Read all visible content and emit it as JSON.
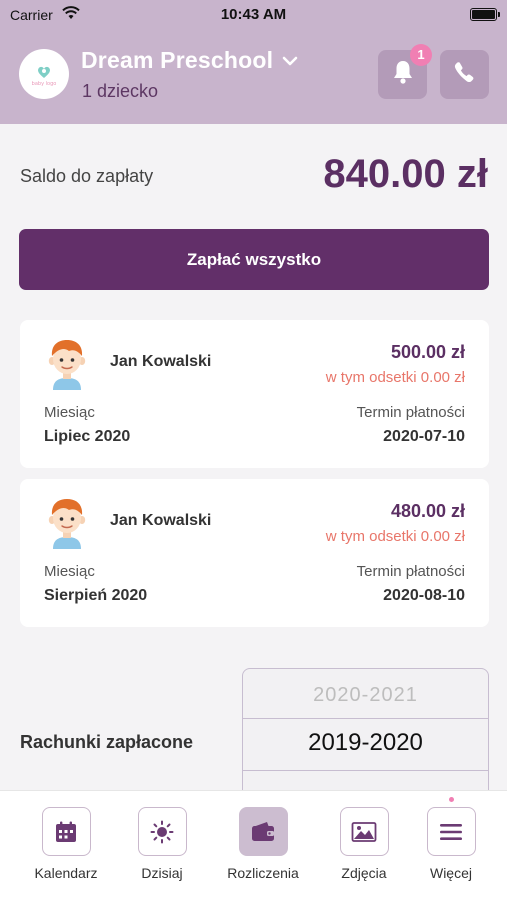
{
  "status_bar": {
    "carrier": "Carrier",
    "time": "10:43 AM"
  },
  "header": {
    "school_name": "Dream Preschool",
    "child_count": "1 dziecko",
    "notification_count": "1",
    "logo_text": "baby logo",
    "icons": [
      "bell-icon",
      "phone-icon",
      "chevron-down-icon"
    ]
  },
  "balance": {
    "label": "Saldo do zapłaty",
    "amount": "840.00 zł",
    "pay_all_label": "Zapłać wszystko"
  },
  "bills": [
    {
      "child_name": "Jan Kowalski",
      "amount": "500.00 zł",
      "interest": "w tym odsetki 0.00 zł",
      "month_label": "Miesiąc",
      "month": "Lipiec 2020",
      "due_label": "Termin płatności",
      "due_date": "2020-07-10"
    },
    {
      "child_name": "Jan Kowalski",
      "amount": "480.00 zł",
      "interest": "w tym odsetki 0.00 zł",
      "month_label": "Miesiąc",
      "month": "Sierpień 2020",
      "due_label": "Termin płatności",
      "due_date": "2020-08-10"
    }
  ],
  "paid": {
    "label": "Rachunki zapłacone",
    "year_options": [
      "2020-2021",
      "2019-2020"
    ],
    "selected_year": "2019-2020"
  },
  "tabs": [
    {
      "label": "Kalendarz",
      "icon": "calendar-icon",
      "active": false
    },
    {
      "label": "Dzisiaj",
      "icon": "sun-icon",
      "active": false
    },
    {
      "label": "Rozliczenia",
      "icon": "wallet-icon",
      "active": true
    },
    {
      "label": "Zdjęcia",
      "icon": "photo-icon",
      "active": false
    },
    {
      "label": "Więcej",
      "icon": "menu-icon",
      "active": false
    }
  ],
  "colors": {
    "header_bg": "#c8b4cc",
    "primary": "#622f69",
    "amount": "#5b2f63",
    "interest": "#e8766a",
    "badge": "#f07fb3"
  }
}
